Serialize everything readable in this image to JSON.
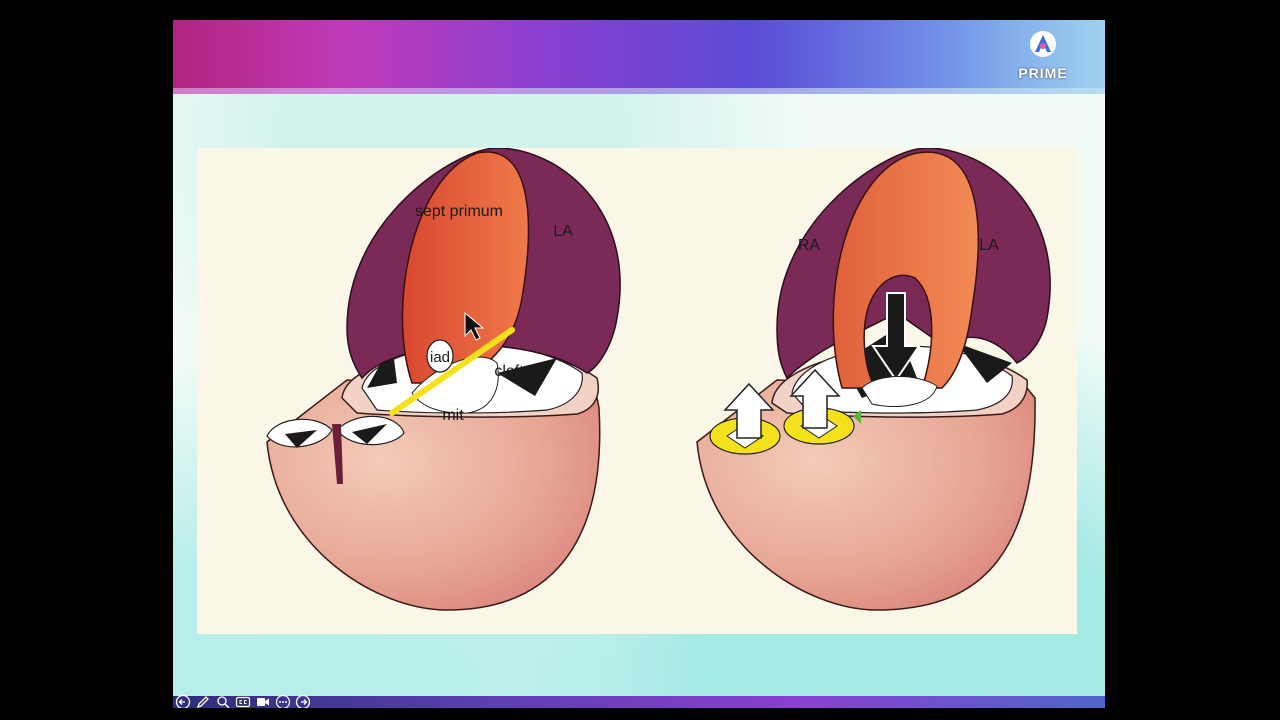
{
  "logo": {
    "text": "PRIME"
  },
  "diagram_left": {
    "labels": {
      "sept_primum": "sept primum",
      "la": "LA",
      "iad": "iad",
      "cleft": "cleft",
      "mit": "mit"
    }
  },
  "diagram_right": {
    "labels": {
      "ra": "RA",
      "la": "LA"
    }
  },
  "toolbar": {
    "icons": [
      "back-icon",
      "pen-icon",
      "zoom-icon",
      "captions-icon",
      "camera-icon",
      "more-icon",
      "forward-icon"
    ]
  },
  "colors": {
    "septum": "#e05a38",
    "atrium": "#7a2a55",
    "ventricle": "#e8a898",
    "highlight_yellow": "#f5e11b"
  }
}
